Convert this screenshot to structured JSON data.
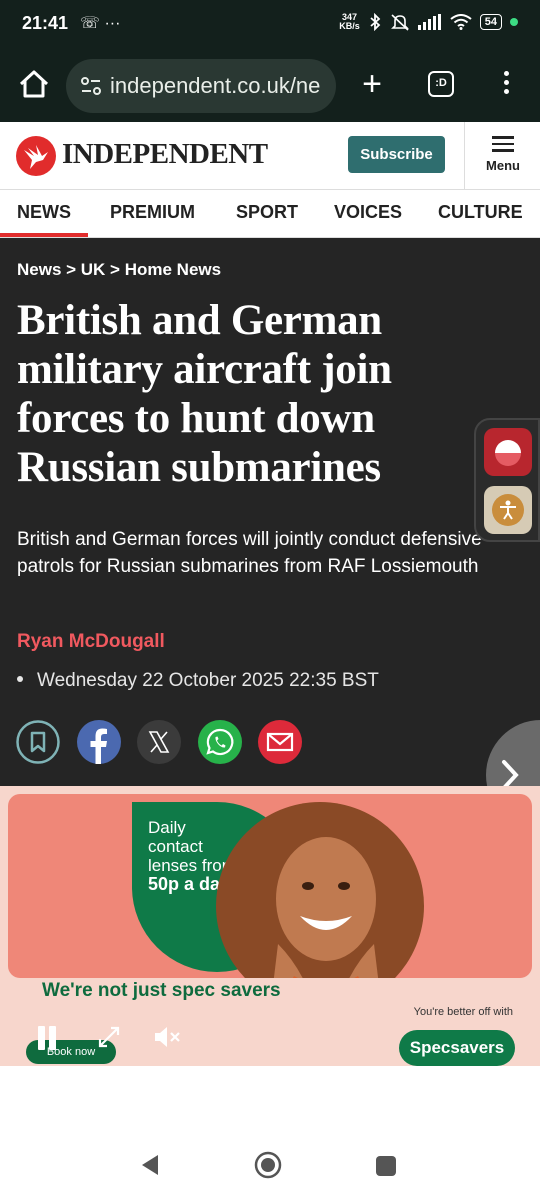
{
  "status": {
    "time": "21:41",
    "left_icons": "☏ ···",
    "speed_value": "347",
    "speed_unit": "KB/s",
    "battery": "54"
  },
  "browser": {
    "url": "independent.co.uk/ne",
    "tab_count": ":D"
  },
  "site": {
    "logo": "INDEPENDENT",
    "subscribe_label": "Subscribe",
    "menu_label": "Menu",
    "brand_color": "#e12c2c"
  },
  "nav": {
    "items": [
      {
        "label": "NEWS",
        "active": true
      },
      {
        "label": "PREMIUM"
      },
      {
        "label": "SPORT"
      },
      {
        "label": "VOICES"
      },
      {
        "label": "CULTURE"
      }
    ]
  },
  "article": {
    "breadcrumb": "News > UK > Home News",
    "headline": "British and German military aircraft join forces to hunt down Russian submarines",
    "standfirst": "British and German forces will jointly conduct defensive patrols for Russian submarines from RAF Lossiemouth",
    "author": "Ryan McDougall",
    "date": "Wednesday 22 October 2025 22:35 BST"
  },
  "ad": {
    "line1": "Daily",
    "line2": "contact",
    "line3": "lenses from",
    "line4": "50p a day",
    "tagline": "We're not just spec savers",
    "better_off": "You're better off with",
    "book_now": "Book now",
    "brand": "Specsavers"
  }
}
